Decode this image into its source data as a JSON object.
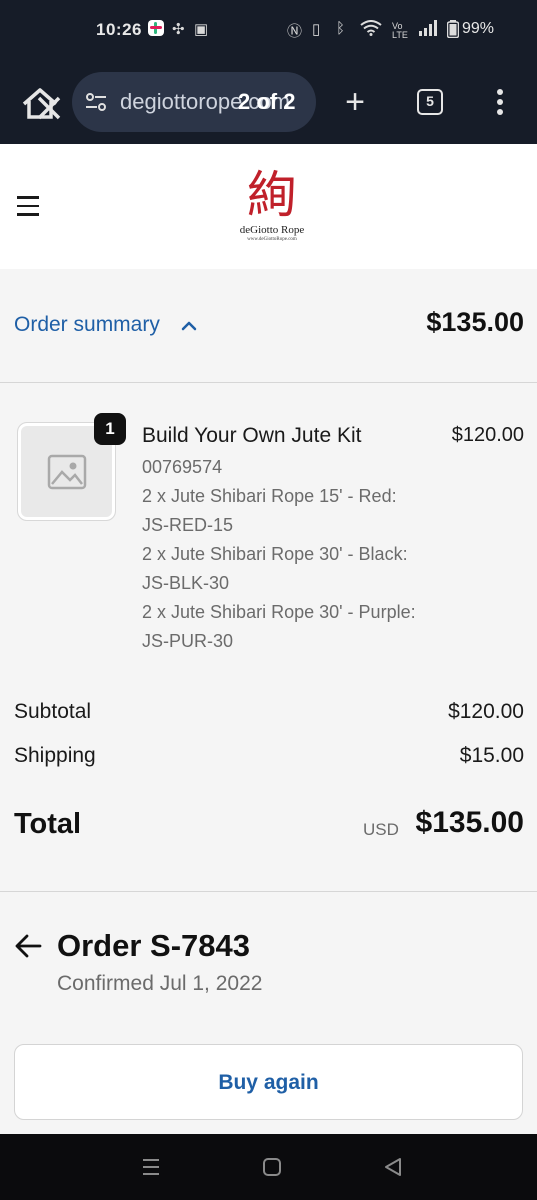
{
  "status_bar": {
    "time": "10:26",
    "battery": "99%",
    "icons": [
      "slack-icon",
      "fan-icon",
      "calendar-icon",
      "nfc-icon",
      "vibrate-icon",
      "bluetooth-icon",
      "wifi-icon",
      "volte-icon",
      "signal-icon",
      "battery-icon"
    ]
  },
  "browser": {
    "url": "degiottorope.com",
    "find_in_page": "2 of 2",
    "tab_count": "5"
  },
  "site": {
    "logo_kanji": "絢",
    "logo_name": "deGiotto Rope",
    "logo_url": "www.deGiottoRope.com"
  },
  "summary": {
    "toggle_label": "Order summary",
    "total": "$135.00"
  },
  "line_item": {
    "quantity": "1",
    "title": "Build Your Own Jute Kit",
    "price": "$120.00",
    "sku": "00769574",
    "components": [
      "2 x Jute Shibari Rope 15' - Red: JS-RED-15",
      "2 x Jute Shibari Rope 30' - Black: JS-BLK-30",
      "2 x Jute Shibari Rope 30' - Purple: JS-PUR-30"
    ]
  },
  "totals": {
    "subtotal_label": "Subtotal",
    "subtotal": "$120.00",
    "shipping_label": "Shipping",
    "shipping": "$15.00",
    "total_label": "Total",
    "currency": "USD",
    "total": "$135.00"
  },
  "order": {
    "title": "Order S-7843",
    "confirmed": "Confirmed Jul 1, 2022",
    "buy_again": "Buy again"
  },
  "colors": {
    "link_blue": "#1f5fa6",
    "logo_red": "#c0202a",
    "browser_chrome": "#161c28"
  }
}
